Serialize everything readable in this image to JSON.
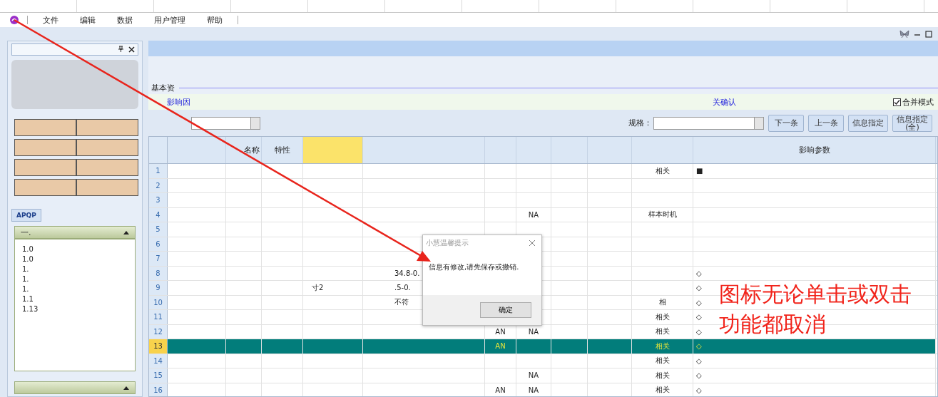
{
  "menu": {
    "items": [
      "文件",
      "编辑",
      "数据",
      "用户管理",
      "帮助"
    ]
  },
  "left_panel": {
    "apqp_button": "APQP",
    "section_title": "一.",
    "list_items": [
      "1.0",
      "1.0",
      "1.",
      "1.",
      "1.",
      "1.1",
      "1.13"
    ]
  },
  "tab": {
    "label": "基本资"
  },
  "link_bar": {
    "left_link": "影响因",
    "right_link": "关确认",
    "merge_mode": {
      "label": "合并模式",
      "checked": true
    }
  },
  "filter": {
    "label": "规格：",
    "buttons": [
      {
        "lines": [
          "下一条"
        ]
      },
      {
        "lines": [
          "上一条"
        ]
      },
      {
        "lines": [
          "信息指定"
        ]
      },
      {
        "lines": [
          "信息指定",
          "(全)"
        ]
      }
    ]
  },
  "grid": {
    "columns": [
      {},
      {
        "label": "名称"
      },
      {
        "label": "特性"
      },
      {
        "highlighted": true
      },
      {},
      {},
      {},
      {},
      {},
      {},
      {
        "label": "影响参数"
      }
    ],
    "rows": [
      {
        "number": "1",
        "selected": false,
        "cells": [
          null,
          null,
          null,
          null,
          null,
          null,
          null,
          null,
          null,
          "相关",
          "■"
        ]
      },
      {
        "number": "2",
        "selected": false,
        "cells": []
      },
      {
        "number": "3",
        "selected": false,
        "cells": []
      },
      {
        "number": "4",
        "selected": false,
        "cells": [
          null,
          null,
          null,
          null,
          null,
          null,
          "NA",
          null,
          null,
          "样本时机",
          null
        ]
      },
      {
        "number": "5",
        "selected": false,
        "cells": []
      },
      {
        "number": "6",
        "selected": false,
        "cells": []
      },
      {
        "number": "7",
        "selected": false,
        "cells": []
      },
      {
        "number": "8",
        "selected": false,
        "cells": [
          null,
          null,
          null,
          null,
          "34.8-0.",
          null,
          null,
          null,
          null,
          null,
          "◇"
        ]
      },
      {
        "number": "9",
        "selected": false,
        "cells": [
          null,
          null,
          null,
          "寸2",
          ".5-0.",
          null,
          null,
          null,
          null,
          null,
          "◇"
        ]
      },
      {
        "number": "10",
        "selected": false,
        "cells": [
          null,
          null,
          null,
          null,
          "不符",
          null,
          null,
          null,
          null,
          "相",
          "◇"
        ]
      },
      {
        "number": "11",
        "selected": false,
        "cells": [
          null,
          null,
          null,
          null,
          null,
          null,
          null,
          null,
          null,
          "相关",
          "◇"
        ]
      },
      {
        "number": "12",
        "selected": false,
        "cells": [
          null,
          null,
          null,
          null,
          null,
          "AN",
          "NA",
          null,
          null,
          "相关",
          "◇"
        ]
      },
      {
        "number": "13",
        "selected": true,
        "cells": [
          null,
          null,
          null,
          null,
          null,
          "AN",
          null,
          null,
          null,
          "相关",
          "◇"
        ]
      },
      {
        "number": "14",
        "selected": false,
        "cells": [
          null,
          null,
          null,
          null,
          null,
          null,
          null,
          null,
          null,
          "相关",
          "◇"
        ]
      },
      {
        "number": "15",
        "selected": false,
        "cells": [
          null,
          null,
          null,
          null,
          null,
          null,
          "NA",
          null,
          null,
          "相关",
          "◇"
        ]
      },
      {
        "number": "16",
        "selected": false,
        "cells": [
          null,
          null,
          null,
          null,
          null,
          "AN",
          "NA",
          null,
          null,
          "相关",
          "◇"
        ]
      }
    ]
  },
  "dialog": {
    "title": "小慧温馨提示",
    "message": "信息有修改,请先保存或撤销.",
    "button": "确定"
  },
  "annotation": {
    "lines": [
      "图标无论单击或双击",
      "功能都取消"
    ]
  }
}
